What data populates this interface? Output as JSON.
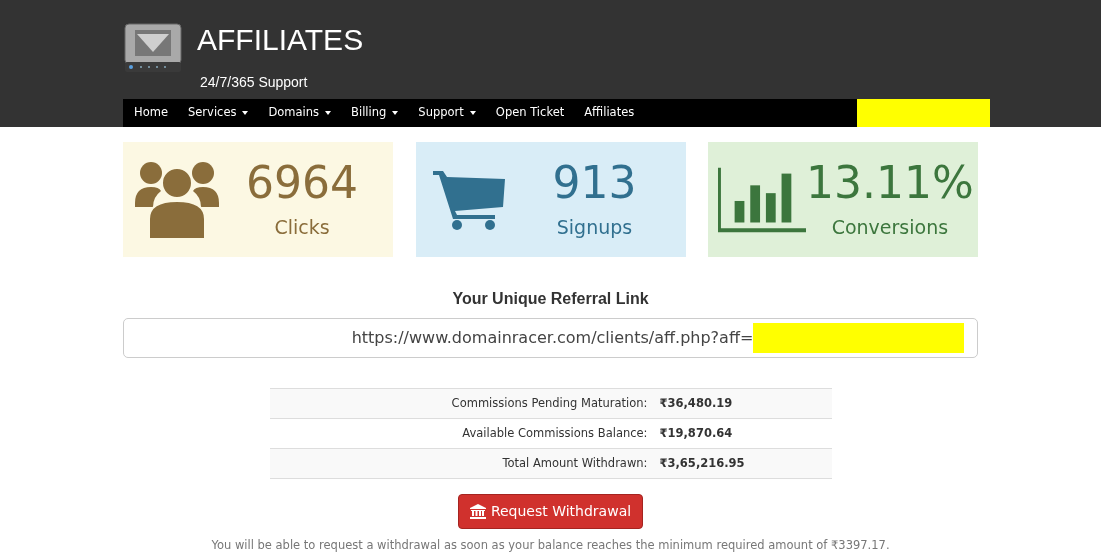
{
  "header": {
    "title": "AFFILIATES",
    "tagline": "24/7/365 Support"
  },
  "nav": [
    {
      "label": "Home",
      "dropdown": false
    },
    {
      "label": "Services",
      "dropdown": true
    },
    {
      "label": "Domains",
      "dropdown": true
    },
    {
      "label": "Billing",
      "dropdown": true
    },
    {
      "label": "Support",
      "dropdown": true
    },
    {
      "label": "Open Ticket",
      "dropdown": false
    },
    {
      "label": "Affiliates",
      "dropdown": false
    }
  ],
  "stats": [
    {
      "kind": "people",
      "value": "6964",
      "label": "Clicks"
    },
    {
      "kind": "cart",
      "value": "913",
      "label": "Signups"
    },
    {
      "kind": "chart",
      "value": "13.11%",
      "label": "Conversions"
    }
  ],
  "referral": {
    "title": "Your Unique Referral Link",
    "link": "https://www.domainracer.com/clients/aff.php?aff="
  },
  "commissions": [
    {
      "label": "Commissions Pending Maturation:",
      "amount": "₹36,480.19"
    },
    {
      "label": "Available Commissions Balance:",
      "amount": "₹19,870.64"
    },
    {
      "label": "Total Amount Withdrawn:",
      "amount": "₹3,65,216.95"
    }
  ],
  "withdraw_button": "Request Withdrawal",
  "note": "You will be able to request a withdrawal as soon as your balance reaches the minimum required amount of ₹3397.17."
}
